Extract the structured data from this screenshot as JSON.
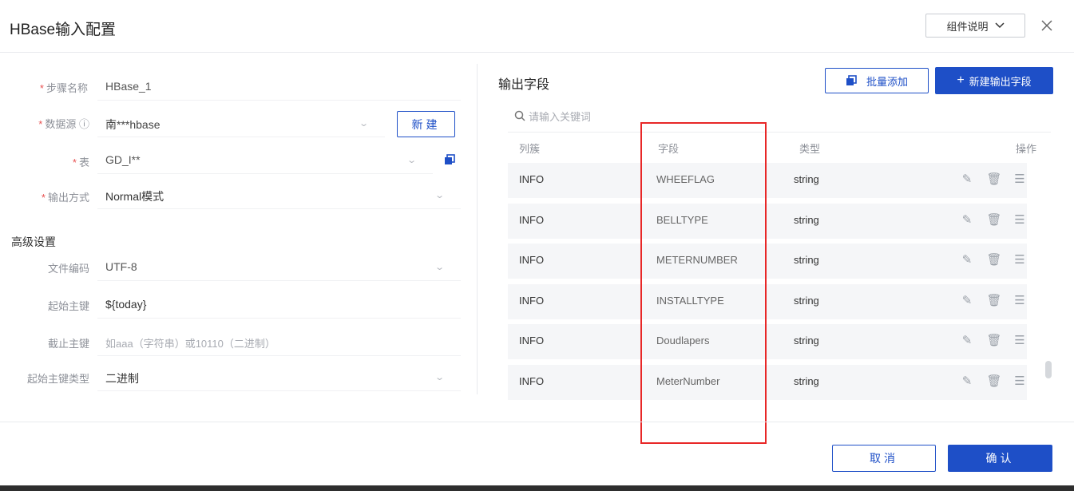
{
  "header": {
    "title": "HBase输入配置",
    "help_label": "组件说明",
    "close_label": "✕"
  },
  "form": {
    "step_name": {
      "label": "步骤名称",
      "value": "HBase_1"
    },
    "datasource": {
      "label": "数据源",
      "info": "ⓘ",
      "value": "南***hbase",
      "new_label": "新建"
    },
    "table": {
      "label": "表",
      "value": "GD_I**"
    },
    "output_mode": {
      "label": "输出方式",
      "value": "Normal模式"
    },
    "advanced_title": "高级设置",
    "encoding": {
      "label": "文件编码",
      "value": "UTF-8"
    },
    "start_key": {
      "label": "起始主键",
      "value": "${today}"
    },
    "stop_key": {
      "label": "截止主键",
      "placeholder": "如aaa（字符串）或10110（二进制）"
    },
    "start_key_type": {
      "label": "起始主键类型",
      "value": "二进制"
    }
  },
  "output_fields": {
    "title": "输出字段",
    "batch_add_label": "批量添加",
    "add_label": "新建输出字段",
    "search_placeholder": "请输入关键词",
    "columns": [
      "列簇",
      "字段",
      "类型",
      "操作"
    ],
    "rows": [
      {
        "family": "INFO",
        "field": "WHEEFLAG",
        "type": "string"
      },
      {
        "family": "INFO",
        "field": "BELLTYPE",
        "type": "string"
      },
      {
        "family": "INFO",
        "field": "METERNUMBER",
        "type": "string"
      },
      {
        "family": "INFO",
        "field": "INSTALLTYPE",
        "type": "string"
      },
      {
        "family": "INFO",
        "field": "Doudlapers",
        "type": "string"
      },
      {
        "family": "INFO",
        "field": "MeterNumber",
        "type": "string"
      }
    ]
  },
  "footer": {
    "cancel_label": "取消",
    "ok_label": "确认"
  },
  "colors": {
    "accent": "#1e4fc7",
    "required": "#e85252",
    "highlight_box": "#e82727"
  }
}
